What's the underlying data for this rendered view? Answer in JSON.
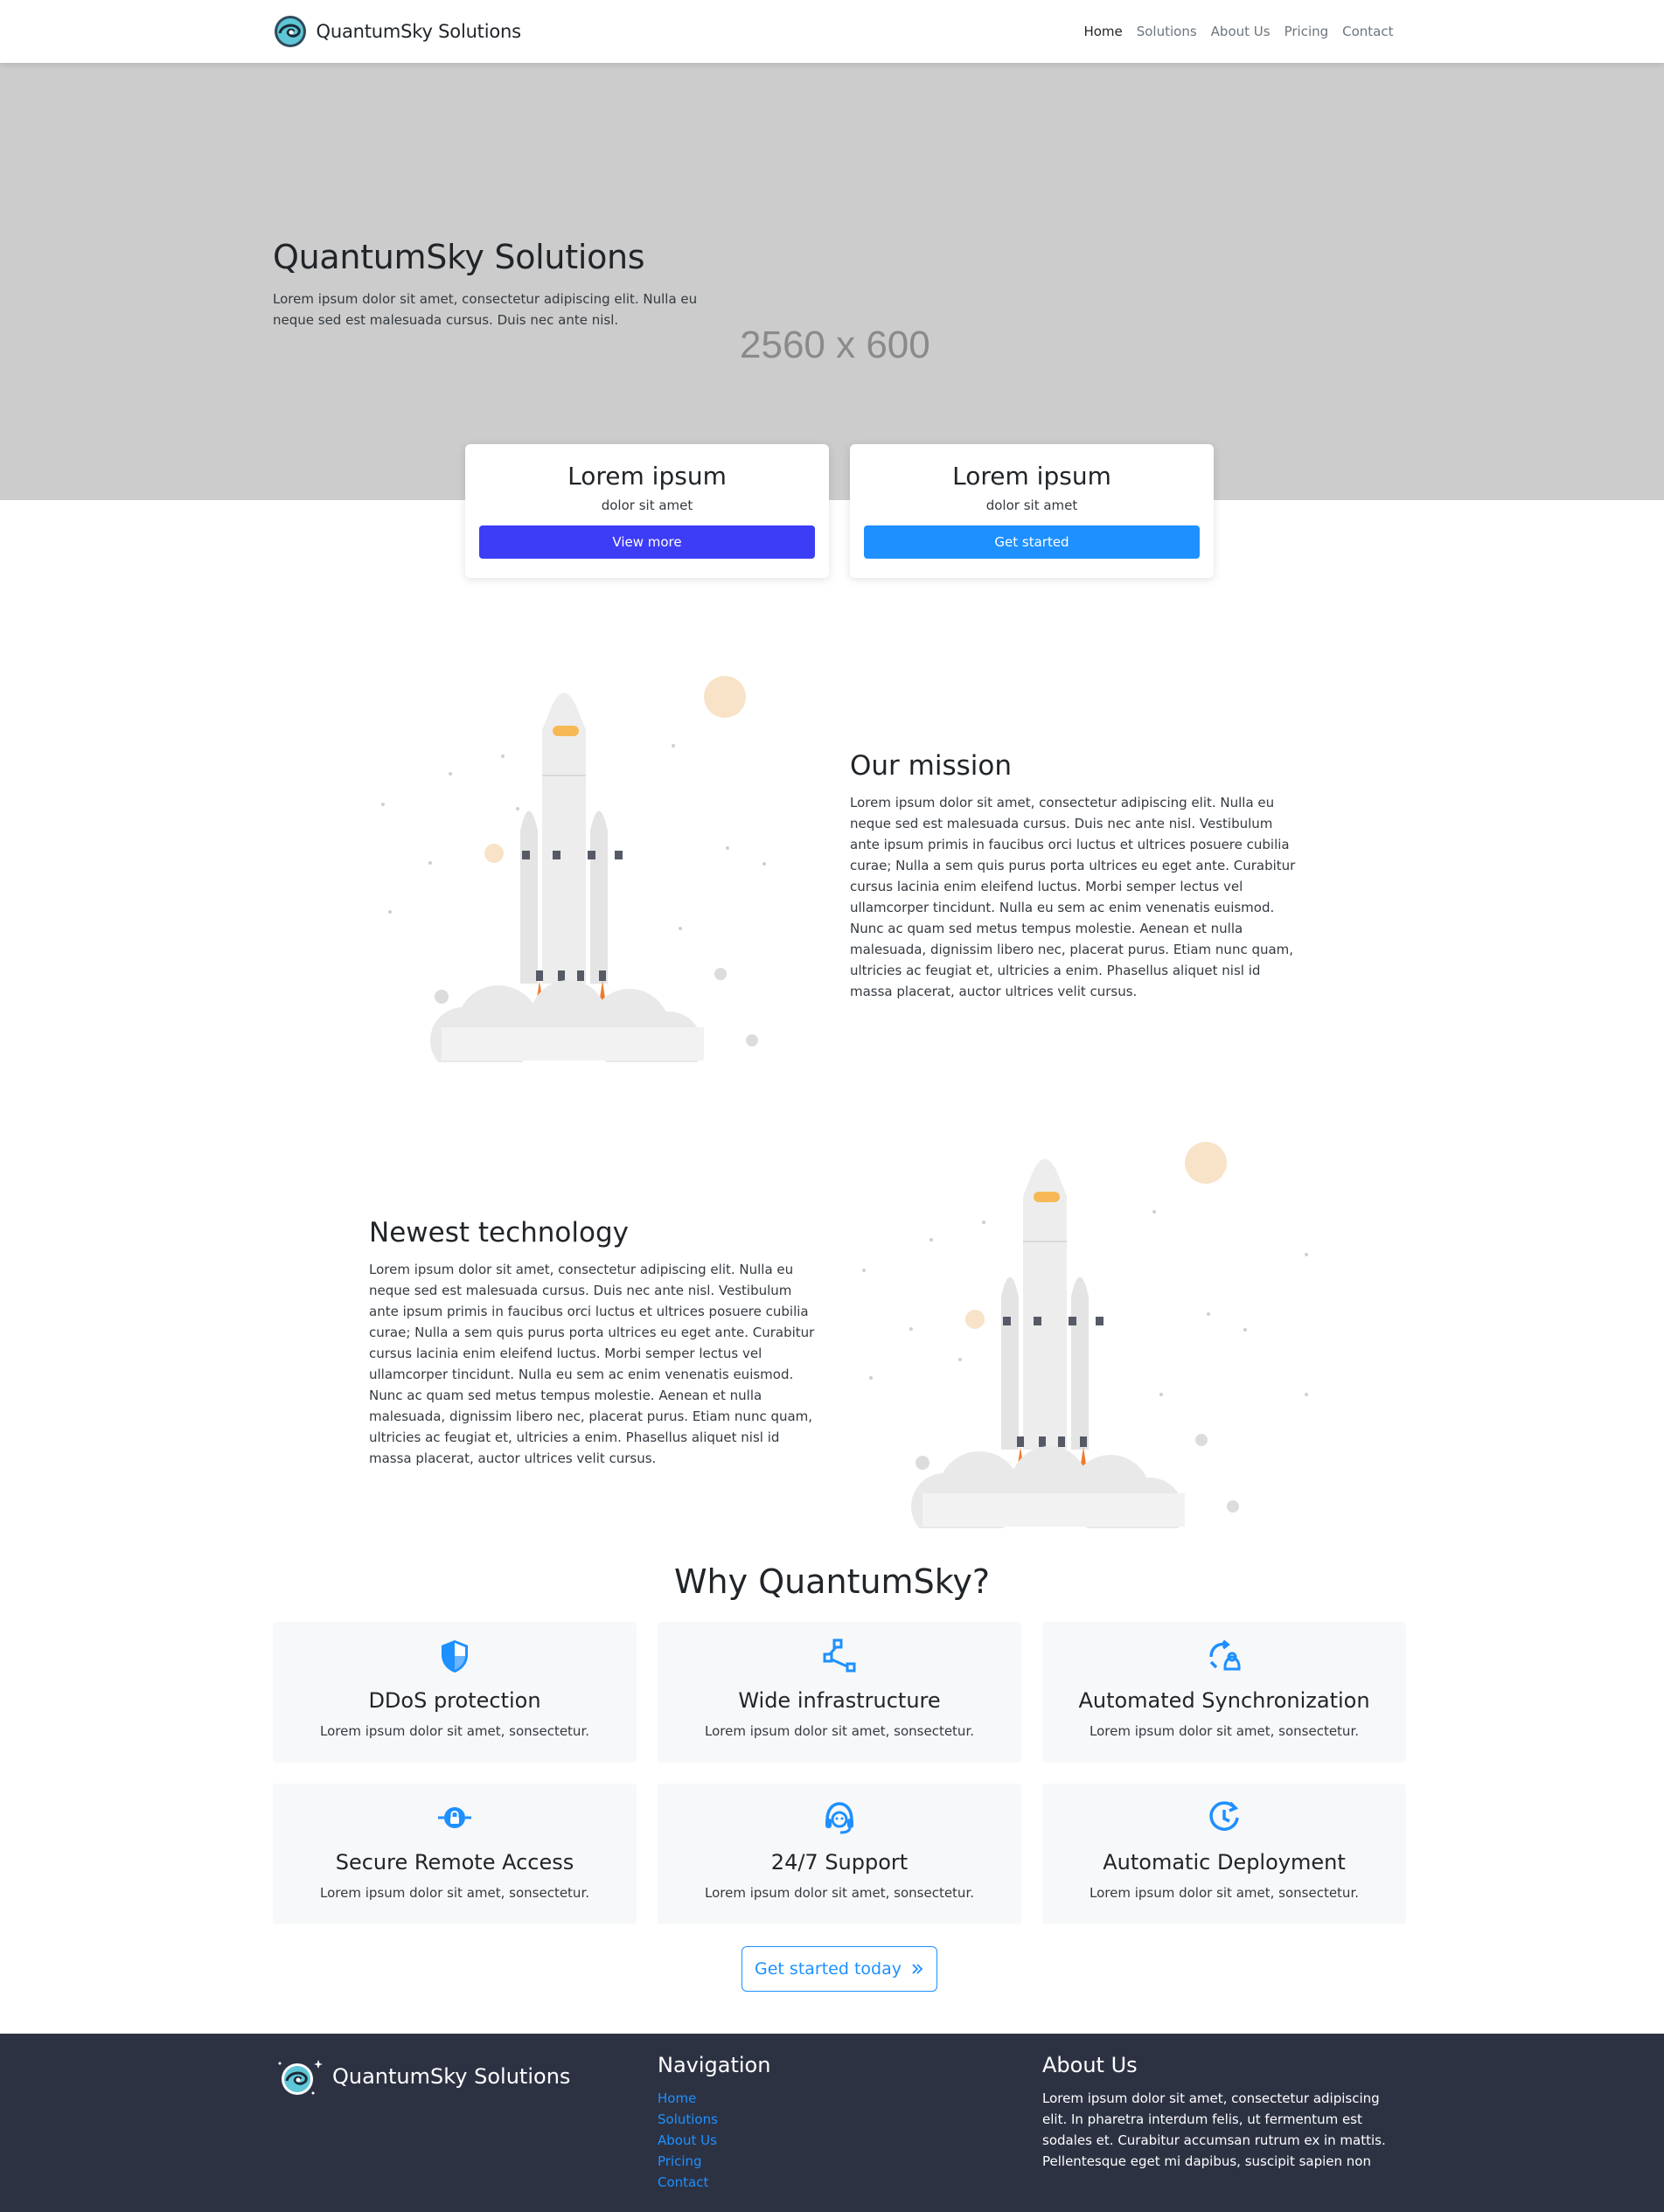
{
  "navbar": {
    "brand": "QuantumSky Solutions",
    "links": [
      {
        "label": "Home",
        "active": true
      },
      {
        "label": "Solutions"
      },
      {
        "label": "About Us"
      },
      {
        "label": "Pricing"
      },
      {
        "label": "Contact"
      }
    ]
  },
  "hero": {
    "title": "QuantumSky Solutions",
    "subtitle": "Lorem ipsum dolor sit amet, consectetur adipiscing elit. Nulla eu neque sed est malesuada cursus. Duis nec ante nisl.",
    "placeholder": "2560 x 600",
    "background": "#cccccc"
  },
  "cta_cards": [
    {
      "title": "Lorem ipsum",
      "text": "dolor sit amet",
      "button": "View more",
      "color": "#3d3df5"
    },
    {
      "title": "Lorem ipsum",
      "text": "dolor sit amet",
      "button": "Get started",
      "color": "#1e90ff"
    }
  ],
  "mission": {
    "title": "Our mission",
    "text": "Lorem ipsum dolor sit amet, consectetur adipiscing elit. Nulla eu neque sed est malesuada cursus. Duis nec ante nisl. Vestibulum ante ipsum primis in faucibus orci luctus et ultrices posuere cubilia curae; Nulla a sem quis purus porta ultrices eu eget ante. Curabitur cursus lacinia enim eleifend luctus. Morbi semper lectus vel ullamcorper tincidunt. Nulla eu sem ac enim venenatis euismod. Nunc ac quam sed metus tempus molestie. Aenean et nulla malesuada, dignissim libero nec, placerat purus. Etiam nunc quam, ultricies ac feugiat et, ultricies a enim. Phasellus aliquet nisl id massa placerat, auctor ultrices velit cursus."
  },
  "technology": {
    "title": "Newest technology",
    "text": "Lorem ipsum dolor sit amet, consectetur adipiscing elit. Nulla eu neque sed est malesuada cursus. Duis nec ante nisl. Vestibulum ante ipsum primis in faucibus orci luctus et ultrices posuere cubilia curae; Nulla a sem quis purus porta ultrices eu eget ante. Curabitur cursus lacinia enim eleifend luctus. Morbi semper lectus vel ullamcorper tincidunt. Nulla eu sem ac enim venenatis euismod. Nunc ac quam sed metus tempus molestie. Aenean et nulla malesuada, dignissim libero nec, placerat purus. Etiam nunc quam, ultricies ac feugiat et, ultricies a enim. Phasellus aliquet nisl id massa placerat, auctor ultrices velit cursus."
  },
  "why": {
    "title": "Why QuantumSky?",
    "cards": [
      {
        "title": "DDoS protection",
        "text": "Lorem ipsum dolor sit amet, sonsectetur.",
        "icon": "shield-icon"
      },
      {
        "title": "Wide infrastructure",
        "text": "Lorem ipsum dolor sit amet, sonsectetur.",
        "icon": "network-icon"
      },
      {
        "title": "Automated Synchronization",
        "text": "Lorem ipsum dolor sit amet, sonsectetur.",
        "icon": "sync-icon"
      },
      {
        "title": "Secure Remote Access",
        "text": "Lorem ipsum dolor sit amet, sonsectetur.",
        "icon": "lock-access-icon"
      },
      {
        "title": "24/7 Support",
        "text": "Lorem ipsum dolor sit amet, sonsectetur.",
        "icon": "headset-icon"
      },
      {
        "title": "Automatic Deployment",
        "text": "Lorem ipsum dolor sit amet, sonsectetur.",
        "icon": "clock-rotate-icon"
      }
    ],
    "cta": "Get started today",
    "accent": "#1e90ff"
  },
  "footer": {
    "brand": "QuantumSky Solutions",
    "nav_title": "Navigation",
    "nav_links": [
      "Home",
      "Solutions",
      "About Us",
      "Pricing",
      "Contact"
    ],
    "about_title": "About Us",
    "about_text": "Lorem ipsum dolor sit amet, consectetur adipiscing elit. In pharetra interdum felis, ut fermentum est sodales et. Curabitur accumsan rutrum ex in mattis. Pellentesque eget mi dapibus, suscipit sapien non",
    "background": "#2d3243"
  }
}
